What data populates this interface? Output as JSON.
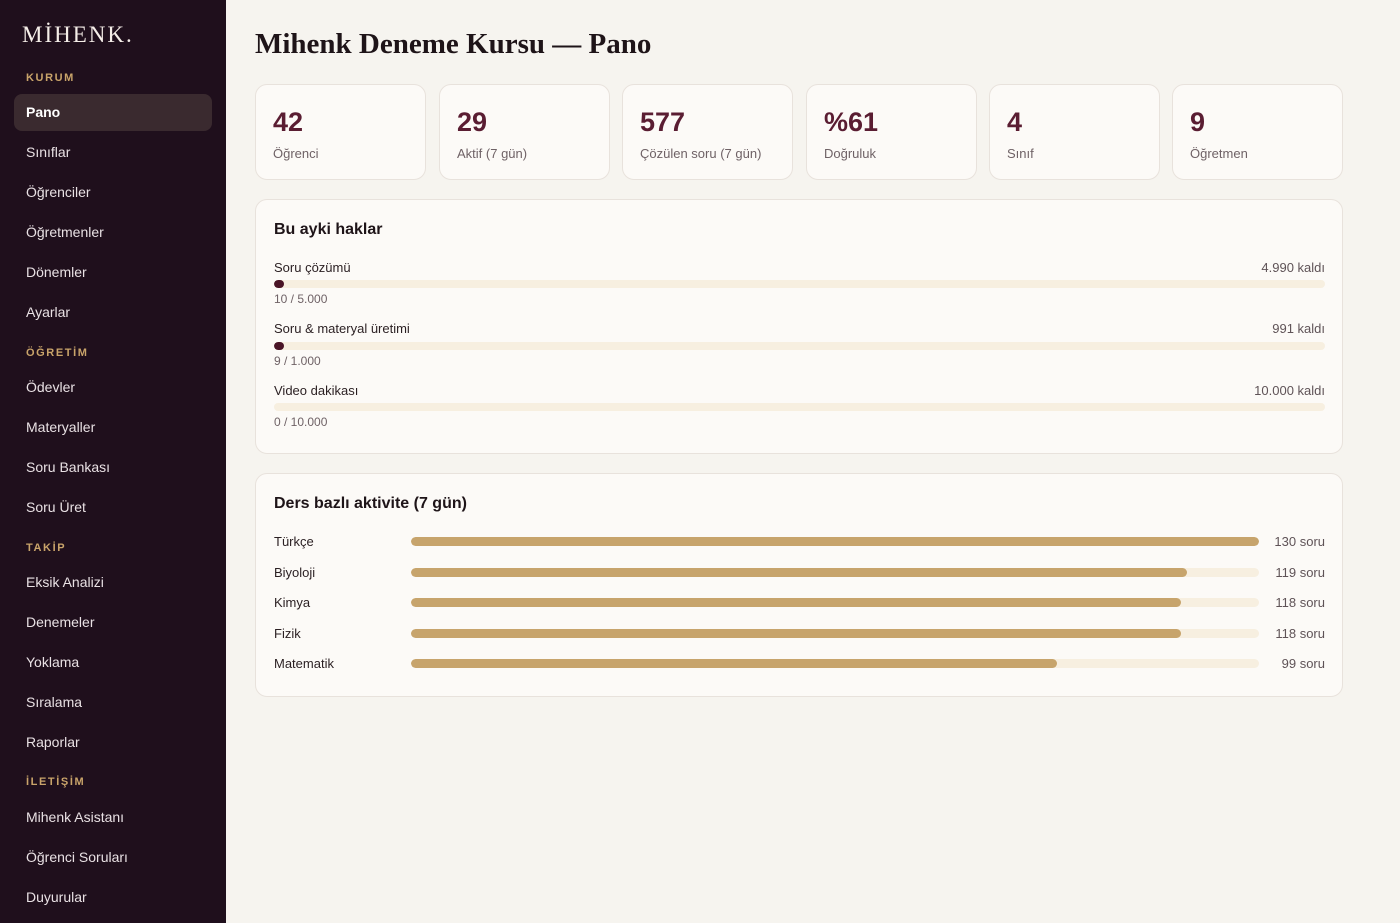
{
  "brand": {
    "name": "MİHENK."
  },
  "sidebar": {
    "sections": [
      {
        "title": "KURUM",
        "items": [
          "Pano",
          "Sınıflar",
          "Öğrenciler",
          "Öğretmenler",
          "Dönemler",
          "Ayarlar"
        ]
      },
      {
        "title": "ÖĞRETİM",
        "items": [
          "Ödevler",
          "Materyaller",
          "Soru Bankası",
          "Soru Üret"
        ]
      },
      {
        "title": "TAKİP",
        "items": [
          "Eksik Analizi",
          "Denemeler",
          "Yoklama",
          "Sıralama",
          "Raporlar"
        ]
      },
      {
        "title": "İLETİŞİM",
        "items": [
          "Mihenk Asistanı",
          "Öğrenci Soruları",
          "Duyurular"
        ]
      }
    ],
    "active_item": "Pano"
  },
  "page": {
    "title": "Mihenk Deneme Kursu — Pano"
  },
  "stats": [
    {
      "value": "42",
      "label": "Öğrenci"
    },
    {
      "value": "29",
      "label": "Aktif (7 gün)"
    },
    {
      "value": "577",
      "label": "Çözülen soru (7 gün)"
    },
    {
      "value": "%61",
      "label": "Doğruluk"
    },
    {
      "value": "4",
      "label": "Sınıf"
    },
    {
      "value": "9",
      "label": "Öğretmen"
    }
  ],
  "quotas": {
    "title": "Bu ayki haklar",
    "items": [
      {
        "label": "Soru çözümü",
        "remaining": "4.990 kaldı",
        "usage": "10 / 5.000",
        "used": 10,
        "limit": 5000
      },
      {
        "label": "Soru & materyal üretimi",
        "remaining": "991 kaldı",
        "usage": "9 / 1.000",
        "used": 9,
        "limit": 1000
      },
      {
        "label": "Video dakikası",
        "remaining": "10.000 kaldı",
        "usage": "0 / 10.000",
        "used": 0,
        "limit": 10000
      }
    ]
  },
  "activity": {
    "title": "Ders bazlı aktivite (7 gün)",
    "max_value": 130,
    "items": [
      {
        "subject": "Türkçe",
        "value": 130,
        "count_label": "130 soru"
      },
      {
        "subject": "Biyoloji",
        "value": 119,
        "count_label": "119 soru"
      },
      {
        "subject": "Kimya",
        "value": 118,
        "count_label": "118 soru"
      },
      {
        "subject": "Fizik",
        "value": 118,
        "count_label": "118 soru"
      },
      {
        "subject": "Matematik",
        "value": 99,
        "count_label": "99 soru"
      }
    ]
  },
  "colors": {
    "sidebar_bg": "#1f0f1c",
    "accent_gold": "#c7a46c",
    "accent_wine": "#5a1d32",
    "page_bg": "#f6f4ef"
  }
}
